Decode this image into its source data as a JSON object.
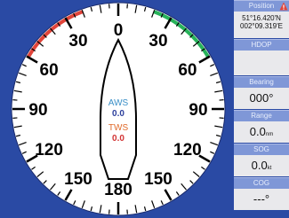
{
  "gauge": {
    "scale_labels": [
      {
        "angle": -150,
        "text": "150"
      },
      {
        "angle": -120,
        "text": "120"
      },
      {
        "angle": -90,
        "text": "90"
      },
      {
        "angle": -60,
        "text": "60"
      },
      {
        "angle": -30,
        "text": "30"
      },
      {
        "angle": 0,
        "text": "0"
      },
      {
        "angle": 30,
        "text": "30"
      },
      {
        "angle": 60,
        "text": "60"
      },
      {
        "angle": 90,
        "text": "90"
      },
      {
        "angle": 120,
        "text": "120"
      },
      {
        "angle": 150,
        "text": "150"
      },
      {
        "angle": 180,
        "text": "180"
      }
    ],
    "aws_label": "AWS",
    "aws_value": "0.0",
    "tws_label": "TWS",
    "tws_value": "0.0",
    "colors": {
      "dial_face": "#ffffff",
      "ticks": "#000000",
      "port_arc": "#e0443a",
      "starboard_arc": "#27b25a",
      "aws": "#3a8fc7",
      "aws_value": "#2c3f9c",
      "tws": "#e06a2a",
      "tws_value": "#d23434",
      "background": "#2a4aa4"
    }
  },
  "side_panel": {
    "position": {
      "header": "Position",
      "lat": "51°16.420'N",
      "lon": "002°09.319'E",
      "warning_icon": "warning-triangle-icon"
    },
    "hdop": {
      "header": "HDOP",
      "value": ""
    },
    "bearing": {
      "header": "Bearing",
      "value": "000°"
    },
    "range": {
      "header": "Range",
      "value": "0.0",
      "unit": "nm"
    },
    "sog": {
      "header": "SOG",
      "value": "0.0",
      "unit": "kt"
    },
    "cog": {
      "header": "COG",
      "value": "---°"
    }
  }
}
